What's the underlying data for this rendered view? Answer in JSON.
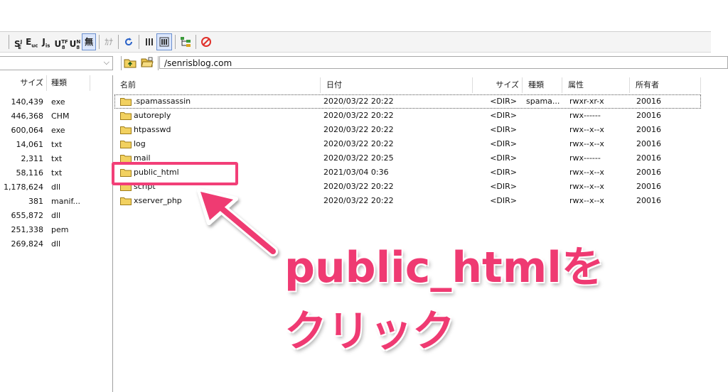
{
  "toolbar": {
    "buttons": [
      {
        "main": "S",
        "sup": "J",
        "sub": "E"
      },
      {
        "main": "E",
        "sub": "uc"
      },
      {
        "main": "J",
        "sub": "is"
      },
      {
        "main": "U",
        "sup": "TF",
        "sub": "8"
      },
      {
        "main": "U",
        "sup": "N",
        "sub": "8"
      }
    ],
    "no_conv_label": "無",
    "kana_label": "ｶﾅ"
  },
  "left": {
    "headers": {
      "size": "サイズ",
      "type": "種類"
    },
    "rows": [
      {
        "size": "140,439",
        "type": "exe"
      },
      {
        "size": "446,368",
        "type": "CHM"
      },
      {
        "size": "600,064",
        "type": "exe"
      },
      {
        "size": "14,061",
        "type": "txt"
      },
      {
        "size": "2,311",
        "type": "txt"
      },
      {
        "size": "58,116",
        "type": "txt"
      },
      {
        "size": "1,178,624",
        "type": "dll"
      },
      {
        "size": "381",
        "type": "manif..."
      },
      {
        "size": "655,872",
        "type": "dll"
      },
      {
        "size": "251,338",
        "type": "pem"
      },
      {
        "size": "269,824",
        "type": "dll"
      }
    ]
  },
  "right": {
    "path": "/senrisblog.com",
    "headers": {
      "name": "名前",
      "date": "日付",
      "size": "サイズ",
      "type": "種類",
      "attr": "属性",
      "owner": "所有者"
    },
    "rows": [
      {
        "name": ".spamassassin",
        "date": "2020/03/22 20:22",
        "size": "<DIR>",
        "type": "spama...",
        "attr": "rwxr-xr-x",
        "owner": "20016"
      },
      {
        "name": "autoreply",
        "date": "2020/03/22 20:22",
        "size": "<DIR>",
        "type": "",
        "attr": "rwx------",
        "owner": "20016"
      },
      {
        "name": "htpasswd",
        "date": "2020/03/22 20:22",
        "size": "<DIR>",
        "type": "",
        "attr": "rwx--x--x",
        "owner": "20016"
      },
      {
        "name": "log",
        "date": "2020/03/22 20:22",
        "size": "<DIR>",
        "type": "",
        "attr": "rwx--x--x",
        "owner": "20016"
      },
      {
        "name": "mail",
        "date": "2020/03/22 20:25",
        "size": "<DIR>",
        "type": "",
        "attr": "rwx------",
        "owner": "20016"
      },
      {
        "name": "public_html",
        "date": "2021/03/04 0:36",
        "size": "<DIR>",
        "type": "",
        "attr": "rwx--x--x",
        "owner": "20016"
      },
      {
        "name": "script",
        "date": "2020/03/22 20:22",
        "size": "<DIR>",
        "type": "",
        "attr": "rwx--x--x",
        "owner": "20016"
      },
      {
        "name": "xserver_php",
        "date": "2020/03/22 20:22",
        "size": "<DIR>",
        "type": "",
        "attr": "rwx--x--x",
        "owner": "20016"
      }
    ]
  },
  "annotation": {
    "line1": "public_htmlを",
    "line2": "クリック",
    "color": "#ef3a72"
  }
}
